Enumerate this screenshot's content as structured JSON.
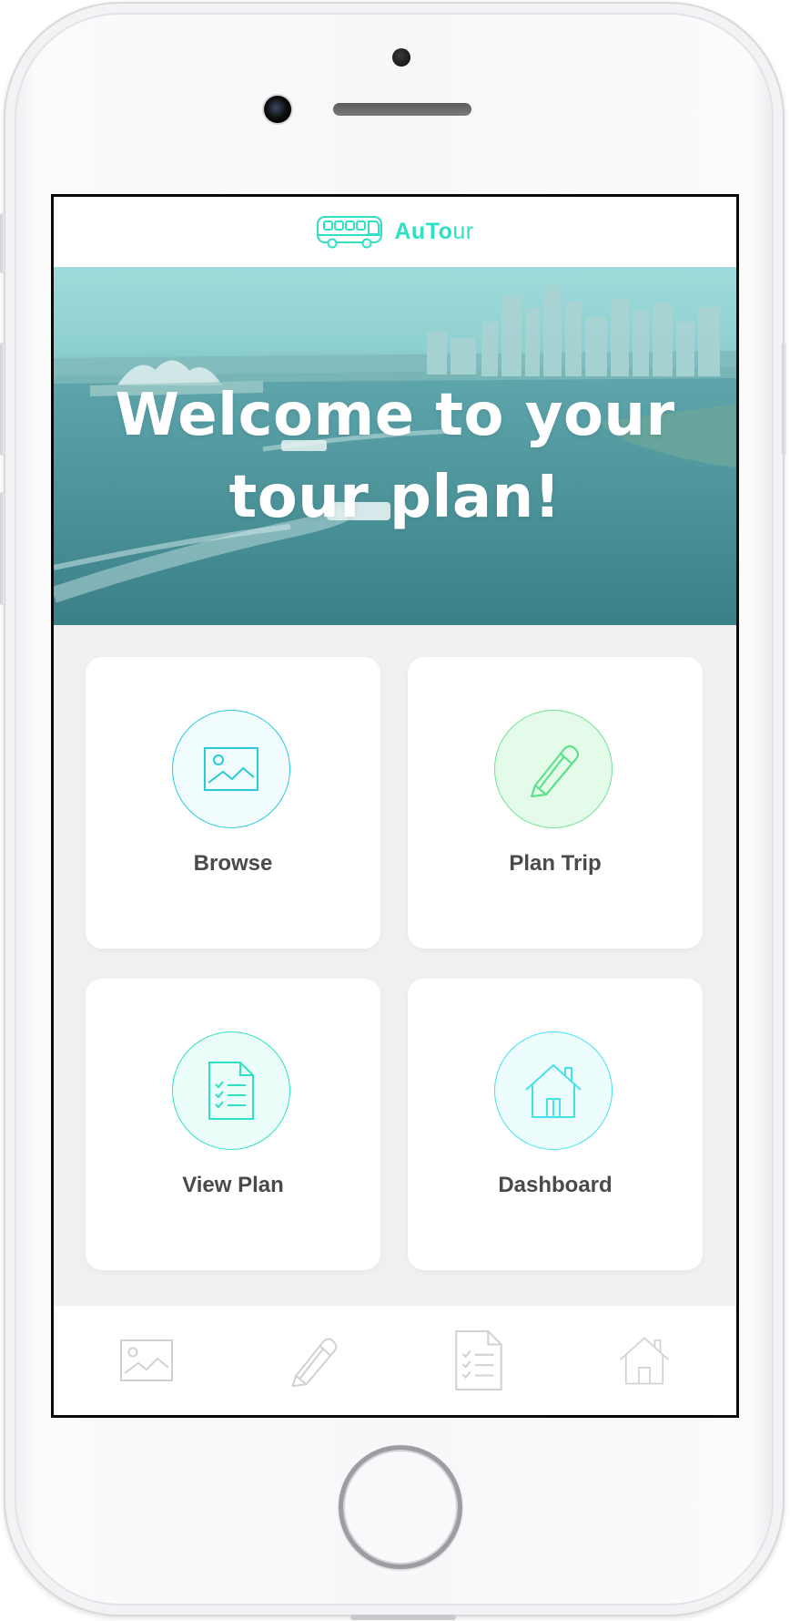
{
  "app": {
    "name_bold": "AuTo",
    "name_light": "ur",
    "logo_icon": "bus-icon",
    "accent_color": "#2fe0c4"
  },
  "hero": {
    "title": "Welcome to your tour plan!"
  },
  "tiles": [
    {
      "label": "Browse",
      "icon": "image-icon"
    },
    {
      "label": "Plan Trip",
      "icon": "pencil-icon"
    },
    {
      "label": "View Plan",
      "icon": "document-checklist-icon"
    },
    {
      "label": "Dashboard",
      "icon": "house-icon"
    }
  ],
  "tabbar": [
    {
      "icon": "image-icon"
    },
    {
      "icon": "pencil-icon"
    },
    {
      "icon": "document-checklist-icon"
    },
    {
      "icon": "house-icon"
    }
  ]
}
